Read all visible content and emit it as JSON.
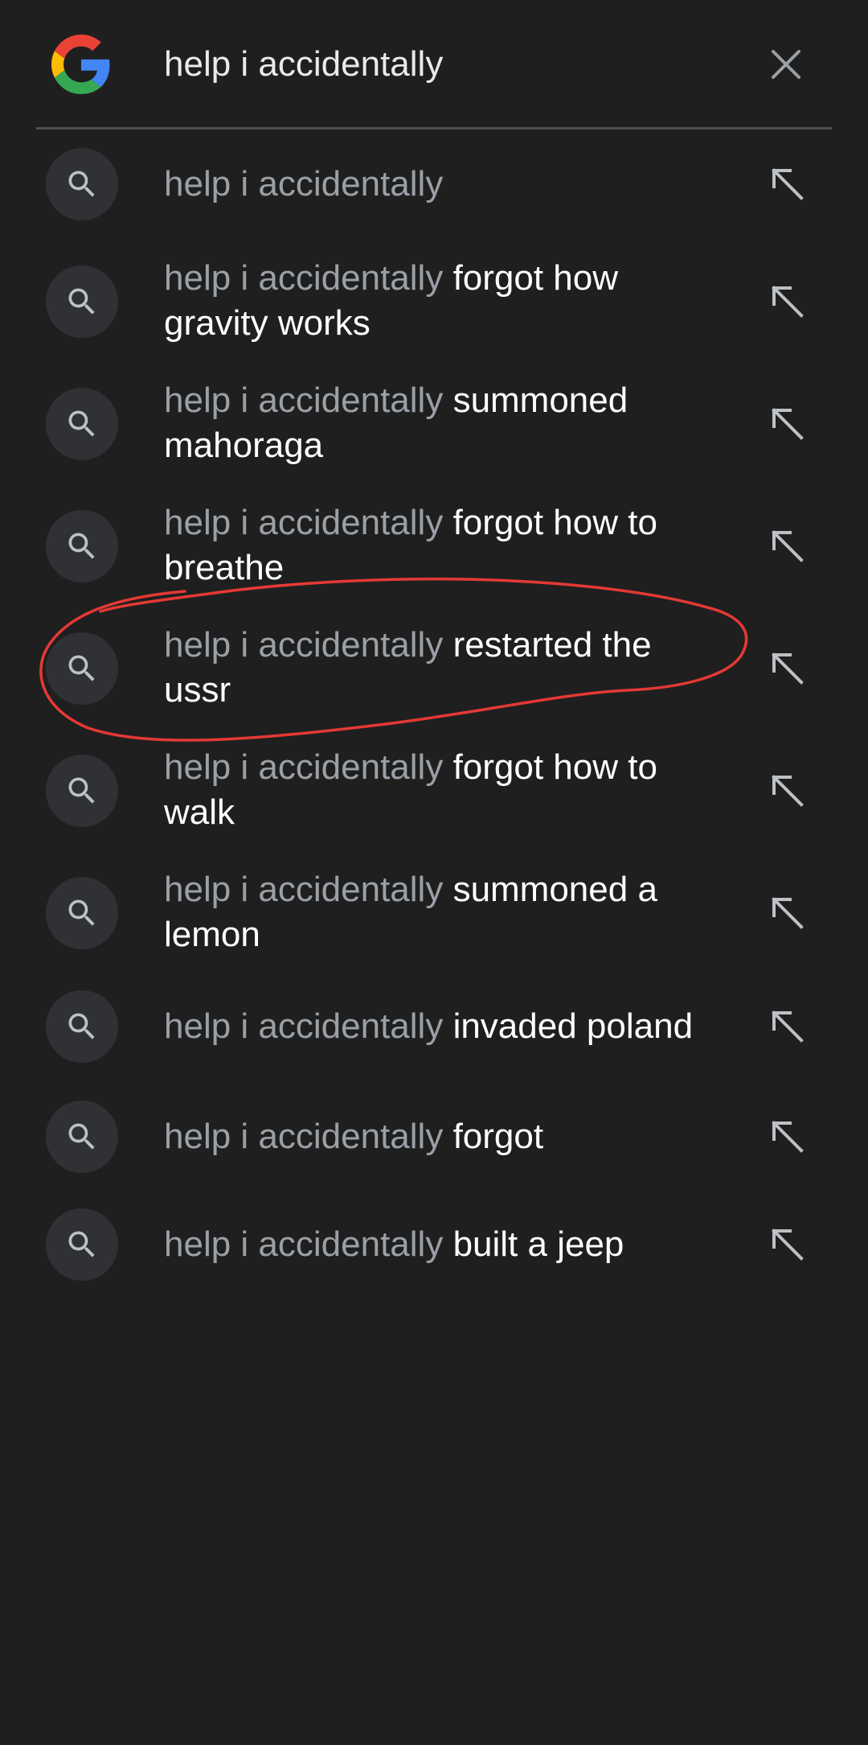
{
  "search": {
    "query": "help i accidentally",
    "clear_icon": "close-icon",
    "logo": "google-g-logo"
  },
  "suggestions": [
    {
      "prefix": "help i accidentally",
      "completion": ""
    },
    {
      "prefix": "help i accidentally",
      "completion": "forgot how gravity works"
    },
    {
      "prefix": "help i accidentally",
      "completion": "summoned mahoraga"
    },
    {
      "prefix": "help i accidentally",
      "completion": "forgot how to breathe"
    },
    {
      "prefix": "help i accidentally",
      "completion": "restarted the ussr"
    },
    {
      "prefix": "help i accidentally",
      "completion": "forgot how to walk"
    },
    {
      "prefix": "help i accidentally",
      "completion": "summoned a lemon"
    },
    {
      "prefix": "help i accidentally",
      "completion": "invaded poland"
    },
    {
      "prefix": "help i accidentally",
      "completion": "forgot"
    },
    {
      "prefix": "help i accidentally",
      "completion": "built a jeep"
    }
  ],
  "icons": {
    "suggestion_leading": "search-icon",
    "suggestion_trailing": "arrow-up-left-icon"
  },
  "colors": {
    "background": "#1f1f1f",
    "prefix_text": "#9aa0a6",
    "completion_text": "#ffffff",
    "icon_circle": "#303134",
    "annotation": "#e53935"
  }
}
